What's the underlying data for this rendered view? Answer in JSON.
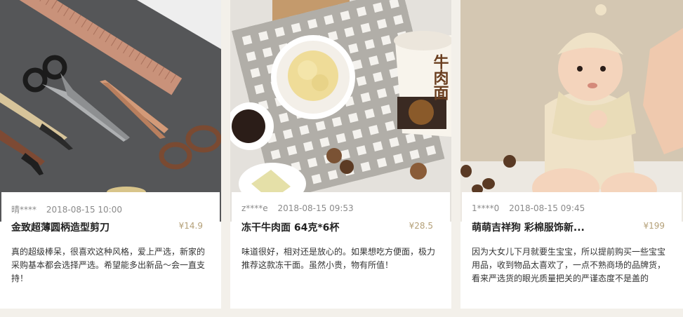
{
  "cards": [
    {
      "user": "晴****",
      "date": "2018-08-15 10:00",
      "title": "金致超薄圆柄造型剪刀",
      "price": "¥14.9",
      "comment": "真的超级棒呆，很喜欢这种风格，爱上严选，新家的采购基本都会选择严选。希望能多出新品～会一直支持！"
    },
    {
      "user": "z****e",
      "date": "2018-08-15 09:53",
      "title": "冻干牛肉面 64克*6杯",
      "price": "¥28.5",
      "comment": "味道很好，相对还是放心的。如果想吃方便面，极力推荐这款冻干面。虽然小贵，物有所值！",
      "cup_label": "牛肉面"
    },
    {
      "user": "1****0",
      "date": "2018-08-15 09:45",
      "title": "萌萌吉祥狗 彩棉服饰新...",
      "price": "¥199",
      "comment": "因为大女儿下月就要生宝宝，所以提前购买一些宝宝用品，收到物品太喜欢了，一点不熟商场的品牌货，看来严选货的眼光质量把关的严谨态度不是盖的"
    }
  ]
}
